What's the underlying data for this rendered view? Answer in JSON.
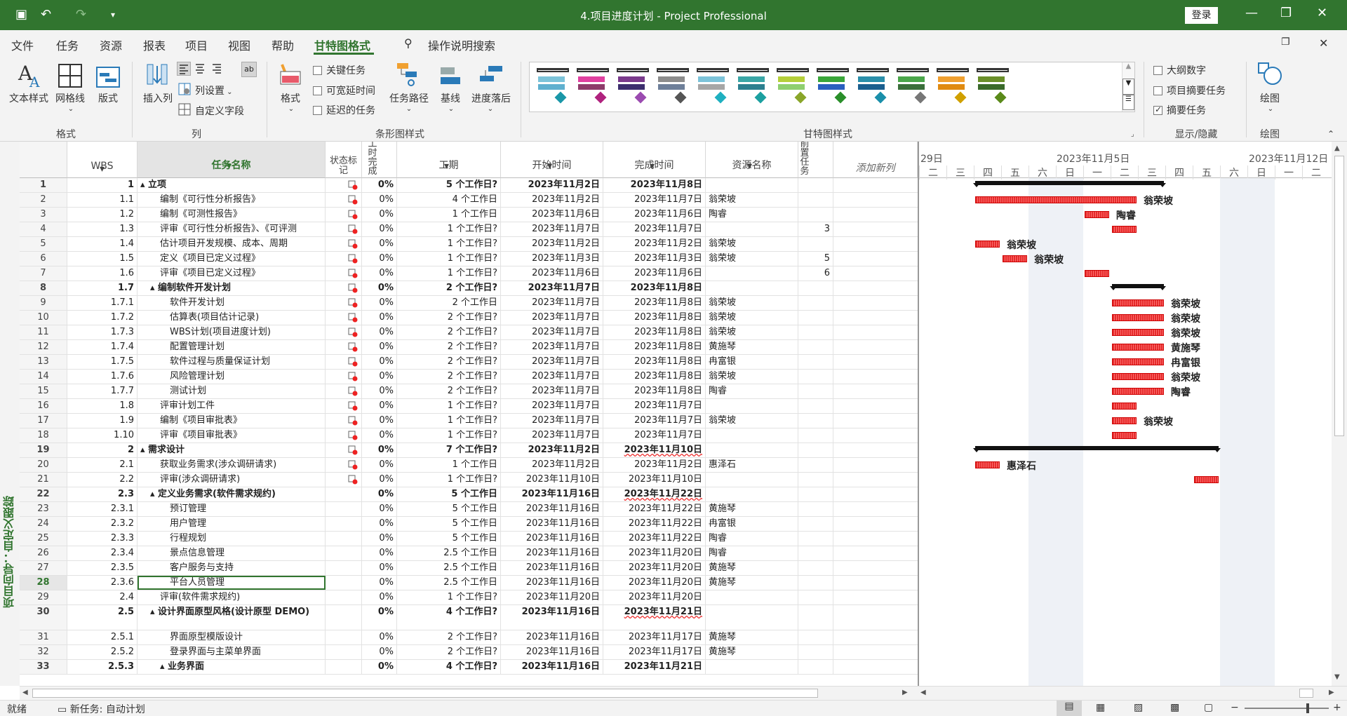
{
  "window": {
    "title": "4.项目进度计划 - Project Professional",
    "login": "登录",
    "undo": "↶",
    "redo": "↷",
    "minimize": "—",
    "maximize": "❐",
    "close": "✕"
  },
  "menu": {
    "items": [
      "文件",
      "任务",
      "资源",
      "报表",
      "项目",
      "视图",
      "帮助",
      "甘特图格式"
    ],
    "search": "操作说明搜索"
  },
  "ribbon": {
    "text_styles": "文本样式",
    "gridlines": "网格线",
    "layout": "版式",
    "group_format": "格式",
    "insert_column": "插入列",
    "column_settings": "列设置",
    "custom_fields": "自定义字段",
    "group_columns": "列",
    "format": "格式",
    "critical_tasks": "关键任务",
    "slack": "可宽延时间",
    "late_tasks": "延迟的任务",
    "task_path": "任务路径",
    "baseline": "基线",
    "slippage": "进度落后",
    "group_bar_styles": "条形图样式",
    "group_gantt_styles": "甘特图样式",
    "outline_number": "大纲数字",
    "project_summary": "项目摘要任务",
    "summary_tasks": "摘要任务",
    "group_show_hide": "显示/隐藏",
    "drawing": "绘图",
    "group_drawing": "绘图",
    "checks": {
      "critical": false,
      "slack": false,
      "late": false,
      "outline": false,
      "project_summary": false,
      "summary": true
    }
  },
  "gallery_colors": [
    [
      "#7cc3d9",
      "#5fb0cf",
      "#1a97a8"
    ],
    [
      "#e040a0",
      "#8e3b6a",
      "#b0227e"
    ],
    [
      "#7a3a8c",
      "#3c2e6e",
      "#9b4bb0"
    ],
    [
      "#8c8c8c",
      "#6e7f99",
      "#555"
    ],
    [
      "#7cc3d9",
      "#a6a6a6",
      "#1fb0c0"
    ],
    [
      "#3aa6a6",
      "#2c7f8f",
      "#1ca0a0"
    ],
    [
      "#b5cf3a",
      "#8fcf6f",
      "#8aa62a"
    ],
    [
      "#3aa63a",
      "#2a5fbf",
      "#2a8f2a"
    ],
    [
      "#2a8faa",
      "#1a5f8f",
      "#1a8faa"
    ],
    [
      "#4aa64a",
      "#3a6f3a",
      "#777"
    ],
    [
      "#f0a030",
      "#e08a10",
      "#d0a000"
    ],
    [
      "#6a8f2a",
      "#3a6a2a",
      "#5a8a1a"
    ]
  ],
  "sidebar": {
    "view_label": "项目向导：自定义跟踪"
  },
  "table": {
    "headers": {
      "wbs": "WBS",
      "name": "任务名称",
      "indicator": "状态标记",
      "pct": "工时完成",
      "duration": "工期",
      "start": "开始时间",
      "finish": "完成时间",
      "resource": "资源名称",
      "pred": "前置任务",
      "add": "添加新列"
    },
    "rows": [
      {
        "id": "1",
        "wbs": "1",
        "name": "▴ 立项",
        "pct": "0%",
        "dur": "5 个工作日?",
        "start": "2023年11月2日",
        "fin": "2023年11月8日",
        "res": "",
        "pred": "",
        "bold": true,
        "lvl": 0,
        "ind": true
      },
      {
        "id": "2",
        "wbs": "1.1",
        "name": "编制《可行性分析报告》",
        "pct": "0%",
        "dur": "4 个工作日",
        "start": "2023年11月2日",
        "fin": "2023年11月7日",
        "res": "翁荣坡",
        "pred": "",
        "lvl": 1,
        "ind": true
      },
      {
        "id": "3",
        "wbs": "1.2",
        "name": "编制《可测性报告》",
        "pct": "0%",
        "dur": "1 个工作日",
        "start": "2023年11月6日",
        "fin": "2023年11月6日",
        "res": "陶睿",
        "pred": "",
        "lvl": 1,
        "ind": true
      },
      {
        "id": "4",
        "wbs": "1.3",
        "name": "评审《可行性分析报告》、《可评测",
        "pct": "0%",
        "dur": "1 个工作日?",
        "start": "2023年11月7日",
        "fin": "2023年11月7日",
        "res": "",
        "pred": "3",
        "lvl": 1,
        "ind": true
      },
      {
        "id": "5",
        "wbs": "1.4",
        "name": "估计项目开发规模、成本、周期",
        "pct": "0%",
        "dur": "1 个工作日?",
        "start": "2023年11月2日",
        "fin": "2023年11月2日",
        "res": "翁荣坡",
        "pred": "",
        "lvl": 1,
        "ind": true
      },
      {
        "id": "6",
        "wbs": "1.5",
        "name": "定义《项目已定义过程》",
        "pct": "0%",
        "dur": "1 个工作日?",
        "start": "2023年11月3日",
        "fin": "2023年11月3日",
        "res": "翁荣坡",
        "pred": "5",
        "lvl": 1,
        "ind": true
      },
      {
        "id": "7",
        "wbs": "1.6",
        "name": "评审《项目已定义过程》",
        "pct": "0%",
        "dur": "1 个工作日?",
        "start": "2023年11月6日",
        "fin": "2023年11月6日",
        "res": "",
        "pred": "6",
        "lvl": 1,
        "ind": true
      },
      {
        "id": "8",
        "wbs": "1.7",
        "name": "▴ 编制软件开发计划",
        "pct": "0%",
        "dur": "2 个工作日?",
        "start": "2023年11月7日",
        "fin": "2023年11月8日",
        "res": "",
        "pred": "",
        "bold": true,
        "lvl": 1,
        "ind": true
      },
      {
        "id": "9",
        "wbs": "1.7.1",
        "name": "软件开发计划",
        "pct": "0%",
        "dur": "2 个工作日",
        "start": "2023年11月7日",
        "fin": "2023年11月8日",
        "res": "翁荣坡",
        "pred": "",
        "lvl": 2,
        "ind": true
      },
      {
        "id": "10",
        "wbs": "1.7.2",
        "name": "估算表(项目估计记录)",
        "pct": "0%",
        "dur": "2 个工作日?",
        "start": "2023年11月7日",
        "fin": "2023年11月8日",
        "res": "翁荣坡",
        "pred": "",
        "lvl": 2,
        "ind": true
      },
      {
        "id": "11",
        "wbs": "1.7.3",
        "name": "WBS计划(项目进度计划)",
        "pct": "0%",
        "dur": "2 个工作日?",
        "start": "2023年11月7日",
        "fin": "2023年11月8日",
        "res": "翁荣坡",
        "pred": "",
        "lvl": 2,
        "ind": true
      },
      {
        "id": "12",
        "wbs": "1.7.4",
        "name": "配置管理计划",
        "pct": "0%",
        "dur": "2 个工作日?",
        "start": "2023年11月7日",
        "fin": "2023年11月8日",
        "res": "黄施琴",
        "pred": "",
        "lvl": 2,
        "ind": true
      },
      {
        "id": "13",
        "wbs": "1.7.5",
        "name": "软件过程与质量保证计划",
        "pct": "0%",
        "dur": "2 个工作日?",
        "start": "2023年11月7日",
        "fin": "2023年11月8日",
        "res": "冉富银",
        "pred": "",
        "lvl": 2,
        "ind": true
      },
      {
        "id": "14",
        "wbs": "1.7.6",
        "name": "风险管理计划",
        "pct": "0%",
        "dur": "2 个工作日?",
        "start": "2023年11月7日",
        "fin": "2023年11月8日",
        "res": "翁荣坡",
        "pred": "",
        "lvl": 2,
        "ind": true
      },
      {
        "id": "15",
        "wbs": "1.7.7",
        "name": "测试计划",
        "pct": "0%",
        "dur": "2 个工作日?",
        "start": "2023年11月7日",
        "fin": "2023年11月8日",
        "res": "陶睿",
        "pred": "",
        "lvl": 2,
        "ind": true
      },
      {
        "id": "16",
        "wbs": "1.8",
        "name": "评审计划工件",
        "pct": "0%",
        "dur": "1 个工作日?",
        "start": "2023年11月7日",
        "fin": "2023年11月7日",
        "res": "",
        "pred": "",
        "lvl": 1,
        "ind": true
      },
      {
        "id": "17",
        "wbs": "1.9",
        "name": "编制《项目审批表》",
        "pct": "0%",
        "dur": "1 个工作日?",
        "start": "2023年11月7日",
        "fin": "2023年11月7日",
        "res": "翁荣坡",
        "pred": "",
        "lvl": 1,
        "ind": true
      },
      {
        "id": "18",
        "wbs": "1.10",
        "name": "评审《项目审批表》",
        "pct": "0%",
        "dur": "1 个工作日?",
        "start": "2023年11月7日",
        "fin": "2023年11月7日",
        "res": "",
        "pred": "",
        "lvl": 1,
        "ind": true
      },
      {
        "id": "19",
        "wbs": "2",
        "name": "▴ 需求设计",
        "pct": "0%",
        "dur": "7 个工作日?",
        "start": "2023年11月2日",
        "fin": "2023年11月10日",
        "res": "",
        "pred": "",
        "bold": true,
        "lvl": 0,
        "ind": true,
        "redfin": true
      },
      {
        "id": "20",
        "wbs": "2.1",
        "name": "获取业务需求(涉众调研请求)",
        "pct": "0%",
        "dur": "1 个工作日",
        "start": "2023年11月2日",
        "fin": "2023年11月2日",
        "res": "惠泽石",
        "pred": "",
        "lvl": 1,
        "ind": true
      },
      {
        "id": "21",
        "wbs": "2.2",
        "name": "评审(涉众调研请求)",
        "pct": "0%",
        "dur": "1 个工作日?",
        "start": "2023年11月10日",
        "fin": "2023年11月10日",
        "res": "",
        "pred": "",
        "lvl": 1,
        "ind": true
      },
      {
        "id": "22",
        "wbs": "2.3",
        "name": "▴ 定义业务需求(软件需求规约)",
        "pct": "0%",
        "dur": "5 个工作日",
        "start": "2023年11月16日",
        "fin": "2023年11月22日",
        "res": "",
        "pred": "",
        "bold": true,
        "lvl": 1,
        "redfin": true
      },
      {
        "id": "23",
        "wbs": "2.3.1",
        "name": "预订管理",
        "pct": "0%",
        "dur": "5 个工作日",
        "start": "2023年11月16日",
        "fin": "2023年11月22日",
        "res": "黄施琴",
        "pred": "",
        "lvl": 2
      },
      {
        "id": "24",
        "wbs": "2.3.2",
        "name": "用户管理",
        "pct": "0%",
        "dur": "5 个工作日",
        "start": "2023年11月16日",
        "fin": "2023年11月22日",
        "res": "冉富银",
        "pred": "",
        "lvl": 2
      },
      {
        "id": "25",
        "wbs": "2.3.3",
        "name": "行程规划",
        "pct": "0%",
        "dur": "5 个工作日",
        "start": "2023年11月16日",
        "fin": "2023年11月22日",
        "res": "陶睿",
        "pred": "",
        "lvl": 2
      },
      {
        "id": "26",
        "wbs": "2.3.4",
        "name": "景点信息管理",
        "pct": "0%",
        "dur": "2.5 个工作日",
        "start": "2023年11月16日",
        "fin": "2023年11月20日",
        "res": "陶睿",
        "pred": "",
        "lvl": 2
      },
      {
        "id": "27",
        "wbs": "2.3.5",
        "name": "客户服务与支持",
        "pct": "0%",
        "dur": "2.5 个工作日",
        "start": "2023年11月16日",
        "fin": "2023年11月20日",
        "res": "黄施琴",
        "pred": "",
        "lvl": 2
      },
      {
        "id": "28",
        "wbs": "2.3.6",
        "name": "平台人员管理",
        "pct": "0%",
        "dur": "2.5 个工作日",
        "start": "2023年11月16日",
        "fin": "2023年11月20日",
        "res": "黄施琴",
        "pred": "",
        "lvl": 2,
        "sel": true
      },
      {
        "id": "29",
        "wbs": "2.4",
        "name": "评审(软件需求规约)",
        "pct": "0%",
        "dur": "1 个工作日?",
        "start": "2023年11月20日",
        "fin": "2023年11月20日",
        "res": "",
        "pred": "",
        "lvl": 1
      },
      {
        "id": "30",
        "wbs": "2.5",
        "name": "▴ 设计界面原型风格(设计原型 DEMO)",
        "pct": "0%",
        "dur": "4 个工作日?",
        "start": "2023年11月16日",
        "fin": "2023年11月21日",
        "res": "",
        "pred": "",
        "bold": true,
        "lvl": 1,
        "tall": true,
        "redfin": true
      },
      {
        "id": "31",
        "wbs": "2.5.1",
        "name": "界面原型模版设计",
        "pct": "0%",
        "dur": "2 个工作日?",
        "start": "2023年11月16日",
        "fin": "2023年11月17日",
        "res": "黄施琴",
        "pred": "",
        "lvl": 2
      },
      {
        "id": "32",
        "wbs": "2.5.2",
        "name": "登录界面与主菜单界面",
        "pct": "0%",
        "dur": "2 个工作日?",
        "start": "2023年11月16日",
        "fin": "2023年11月17日",
        "res": "黄施琴",
        "pred": "",
        "lvl": 2
      },
      {
        "id": "33",
        "wbs": "2.5.3",
        "name": "▴ 业务界面",
        "pct": "0%",
        "dur": "4 个工作日?",
        "start": "2023年11月16日",
        "fin": "2023年11月21日",
        "res": "",
        "pred": "",
        "bold": true,
        "lvl": 2
      }
    ]
  },
  "gantt": {
    "dates": [
      "29日",
      "2023年11月5日",
      "2023年11月12日"
    ],
    "days": [
      "二",
      "三",
      "四",
      "五",
      "六",
      "日",
      "一",
      "二",
      "三",
      "四",
      "五",
      "六",
      "日",
      "一",
      "二"
    ],
    "labels": [
      "翁荣坡",
      "陶睿",
      "翁荣坡",
      "翁荣坡",
      "翁荣坡",
      "翁荣坡",
      "翁荣坡",
      "黄施琴",
      "冉富银",
      "翁荣坡",
      "陶睿",
      "翁荣坡",
      "惠泽石"
    ]
  },
  "status": {
    "ready": "就绪",
    "new_task": "新任务: 自动计划"
  }
}
